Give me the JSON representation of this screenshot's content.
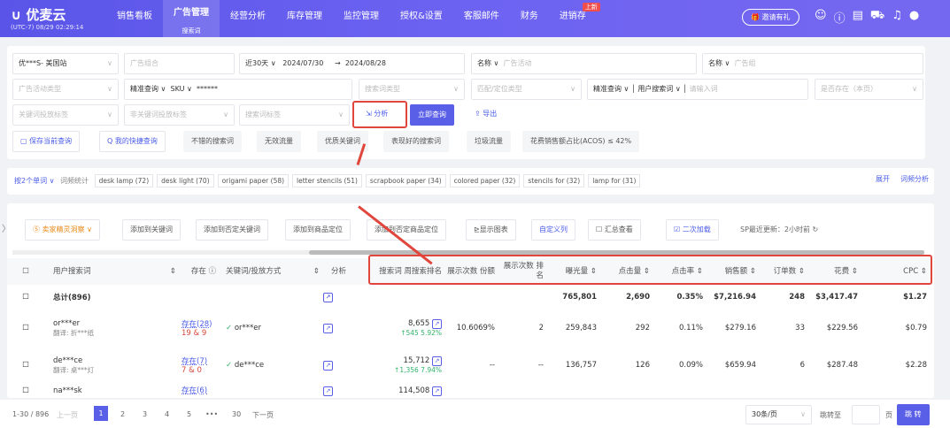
{
  "header": {
    "logo": "优麦云",
    "timezone": "(UTC-7) 08/29 02:29:14",
    "nav": [
      "销售看板",
      "广告管理",
      "经营分析",
      "库存管理",
      "监控管理",
      "授权&设置",
      "客服邮件",
      "财务",
      "进销存"
    ],
    "active_sub": "搜索词",
    "new_badge": "上新",
    "invite": "邀请有礼"
  },
  "filters": {
    "store": "优***S- 美国站",
    "ad_group": "广告组合",
    "range": "近30天",
    "start": "2024/07/30",
    "end": "2024/08/28",
    "name1": "名称",
    "campaign": "广告活动",
    "name2": "名称",
    "adgroup": "广告组",
    "campaign_type": "广告活动类型",
    "exact1": "精准查询",
    "sku": "SKU",
    "sku_value": "******",
    "term_type": "搜索词类型",
    "match_type": "匹配/定位类型",
    "exact2": "精准查询",
    "user_term": "用户搜索词",
    "input_ph": "请输入词",
    "exists": "是否存在（本页）",
    "kw_tag": "关键词投放标签",
    "nonkw_tag": "非关键词投放标签",
    "term_tag": "搜索词标签",
    "analyze": "分析",
    "query": "立即查询",
    "export": "导出"
  },
  "quick": {
    "save": "保存当前查询",
    "mine": "我的快捷查询",
    "items": [
      "不错的搜索词",
      "无效流量",
      "优质关键词",
      "表现好的搜索词",
      "垃圾流量",
      "花费销售额占比(ACOS) ≤ 42%"
    ]
  },
  "words": {
    "mode": "按2个单词",
    "label": "词频统计",
    "chips": [
      "desk lamp (72)",
      "desk light (70)",
      "origami paper (58)",
      "letter stencils (51)",
      "scrapbook paper (34)",
      "colored paper (32)",
      "stencils for (32)",
      "lamp for (31)"
    ],
    "expand": "展开",
    "analysis": "词频分析"
  },
  "toolbar": {
    "tool": "卖家精灵洞察",
    "add_kw": "添加到关键词",
    "add_neg_kw": "添加到否定关键词",
    "add_asin": "添加到商品定位",
    "add_neg_asin": "添加到否定商品定位",
    "show_chart": "显示图表",
    "custom_cols": "自定义列",
    "summary": "汇总查看",
    "reload": "二次加载",
    "update": "SP最近更新：2小时前"
  },
  "table": {
    "headers": [
      "用户搜索词",
      "存在",
      "关键词/投放方式",
      "分析",
      "搜索词 周搜索排名",
      "展示次数 份额",
      "展示次数 排名",
      "曝光量",
      "点击量",
      "点击率",
      "销售额",
      "订单数",
      "花费",
      "CPC"
    ],
    "total": {
      "label": "总计(896)",
      "impressions": "765,801",
      "clicks": "2,690",
      "ctr": "0.35%",
      "sales": "$7,216.94",
      "orders": "248",
      "spend": "$3,417.47",
      "cpc": "$1.27"
    },
    "rows": [
      {
        "term": "or***er",
        "trans": "翻译: 折***纸",
        "exists": "存在(28)",
        "counts": "19 & 9",
        "kw": "or***er",
        "rank": "8,655",
        "rank_up": "↑545  5.92%",
        "share": "10.6069%",
        "share_rank": "2",
        "impressions": "259,843",
        "clicks": "292",
        "ctr": "0.11%",
        "sales": "$279.16",
        "orders": "33",
        "spend": "$229.56",
        "cpc": "$0.79"
      },
      {
        "term": "de***ce",
        "trans": "翻译: 桌***灯",
        "exists": "存在(7)",
        "counts": "7 & 0",
        "kw": "de***ce",
        "rank": "15,712",
        "rank_up": "↑1,356  7.94%",
        "share": "--",
        "share_rank": "--",
        "impressions": "136,757",
        "clicks": "126",
        "ctr": "0.09%",
        "sales": "$659.94",
        "orders": "6",
        "spend": "$287.48",
        "cpc": "$2.28"
      },
      {
        "term": "na***sk",
        "trans": "",
        "exists": "存在(6)",
        "counts": "",
        "kw": "",
        "rank": "114,508",
        "rank_up": "",
        "share": "",
        "share_rank": "",
        "impressions": "",
        "clicks": "",
        "ctr": "",
        "sales": "",
        "orders": "",
        "spend": "",
        "cpc": ""
      }
    ]
  },
  "pagination": {
    "range": "1-30 / 896",
    "prev": "上一页",
    "pages": [
      "1",
      "2",
      "3",
      "4",
      "5",
      "•••",
      "30"
    ],
    "next": "下一页",
    "per_page": "30条/页",
    "goto": "跳转至",
    "page_unit": "页",
    "jump": "跳 转"
  },
  "colors": {
    "brand": "#5a5fe8",
    "highlight": "#e0463c"
  }
}
